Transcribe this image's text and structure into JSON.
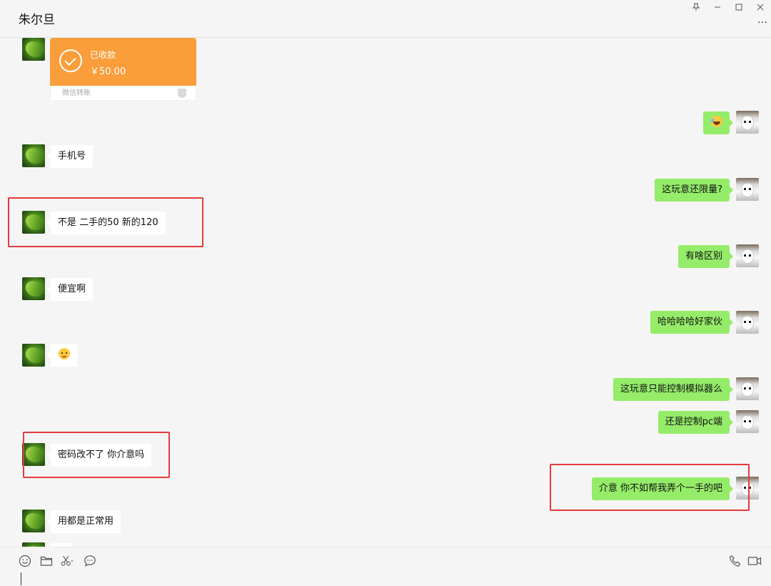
{
  "header": {
    "title": "朱尔旦",
    "pin_icon": "pin-icon",
    "minimize_icon": "minimize-icon",
    "maximize_icon": "maximize-icon",
    "close_icon": "close-icon",
    "more_label": "…"
  },
  "transfer": {
    "status": "已收款",
    "amount": "￥50.00",
    "source": "微信转账"
  },
  "messages": {
    "m1": "",
    "m2": "手机号",
    "m3": "这玩意还限量?",
    "m4": "不是  二手的50   新的120",
    "m5": "有啥区别",
    "m6": "便宜啊",
    "m7": "哈哈哈哈好家伙",
    "m8": "",
    "m9": "这玩意只能控制模拟器么",
    "m10": "还是控制pc端",
    "m11": "密码改不了 你介意吗",
    "m12": "介意   你不如帮我弄个一手的吧",
    "m13": "用都是正常用"
  },
  "emoji": {
    "m1": "laughing-tears-emoji",
    "m8": "shy-face-emoji"
  },
  "toolbar": {
    "emoji_icon": "emoji-icon",
    "folder_icon": "folder-icon",
    "screenshot_icon": "scissors-icon",
    "chat_history_icon": "chat-bubble-icon",
    "voice_call_icon": "phone-icon",
    "video_call_icon": "video-camera-icon"
  },
  "colors": {
    "sent_bubble": "#95ec69",
    "received_bubble": "#ffffff",
    "transfer": "#fa9d3b",
    "highlight": "#e53a3a"
  }
}
